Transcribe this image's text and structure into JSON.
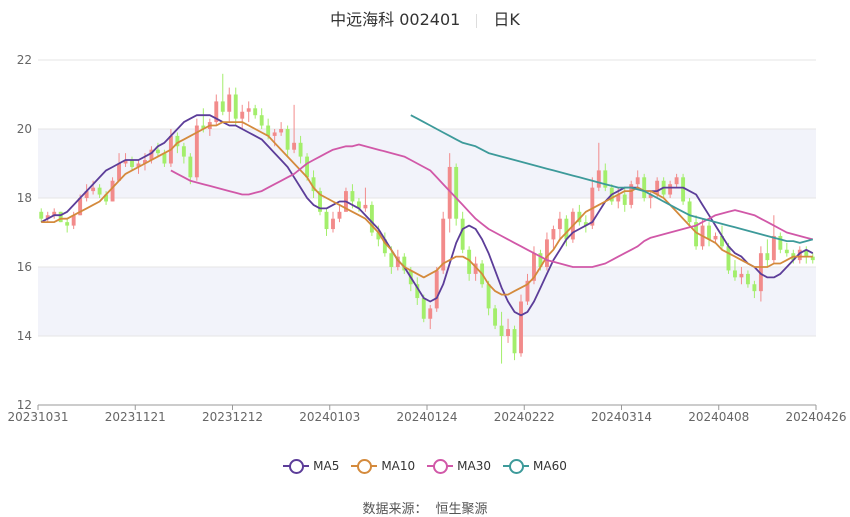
{
  "header": {
    "title": "中远海科 002401",
    "period": "日K"
  },
  "colors": {
    "up": "#f28b8b",
    "down": "#a3ee6b",
    "ma5": "#5c3d99",
    "ma10": "#d48a3c",
    "ma30": "#d158a8",
    "ma60": "#3d9a9a",
    "band": "#f2f3fa",
    "grid": "#e6e6e6"
  },
  "legend": [
    {
      "name": "MA5",
      "color": "#5c3d99"
    },
    {
      "name": "MA10",
      "color": "#d48a3c"
    },
    {
      "name": "MA30",
      "color": "#d158a8"
    },
    {
      "name": "MA60",
      "color": "#3d9a9a"
    }
  ],
  "source": {
    "label": "数据来源：",
    "name": "恒生聚源"
  },
  "chart_data": {
    "type": "candlestick",
    "title": "中远海科 002401 日K",
    "ylim": [
      12,
      22
    ],
    "yticks": [
      12,
      14,
      16,
      18,
      20,
      22
    ],
    "xticks": [
      "20231031",
      "20231121",
      "20231212",
      "20240103",
      "20240124",
      "20240222",
      "20240314",
      "20240408",
      "20240426"
    ],
    "grid": true,
    "legend_position": "bottom",
    "n_days": 120,
    "ohlc": [
      [
        17.6,
        17.7,
        17.3,
        17.4
      ],
      [
        17.4,
        17.6,
        17.3,
        17.5
      ],
      [
        17.5,
        17.7,
        17.4,
        17.6
      ],
      [
        17.6,
        17.6,
        17.3,
        17.3
      ],
      [
        17.3,
        17.4,
        17.0,
        17.2
      ],
      [
        17.2,
        17.6,
        17.1,
        17.5
      ],
      [
        17.5,
        18.1,
        17.5,
        18.0
      ],
      [
        18.0,
        18.4,
        17.9,
        18.2
      ],
      [
        18.2,
        18.5,
        18.1,
        18.3
      ],
      [
        18.3,
        18.4,
        18.0,
        18.1
      ],
      [
        18.1,
        18.2,
        17.8,
        17.9
      ],
      [
        17.9,
        18.6,
        17.9,
        18.5
      ],
      [
        18.5,
        19.3,
        18.5,
        19.0
      ],
      [
        19.0,
        19.3,
        18.9,
        19.1
      ],
      [
        19.1,
        19.2,
        18.8,
        18.9
      ],
      [
        18.9,
        19.1,
        18.7,
        19.0
      ],
      [
        19.0,
        19.3,
        18.8,
        19.1
      ],
      [
        19.1,
        19.5,
        19.0,
        19.4
      ],
      [
        19.4,
        19.6,
        19.2,
        19.3
      ],
      [
        19.3,
        19.4,
        18.9,
        19.0
      ],
      [
        19.0,
        20.0,
        18.9,
        19.8
      ],
      [
        19.8,
        19.9,
        19.3,
        19.5
      ],
      [
        19.5,
        19.6,
        19.0,
        19.2
      ],
      [
        19.2,
        19.3,
        18.4,
        18.6
      ],
      [
        18.6,
        20.3,
        18.5,
        20.1
      ],
      [
        20.1,
        20.6,
        19.9,
        20.0
      ],
      [
        20.0,
        20.3,
        19.8,
        20.2
      ],
      [
        20.2,
        21.0,
        20.1,
        20.8
      ],
      [
        20.8,
        21.6,
        20.4,
        20.5
      ],
      [
        20.5,
        21.2,
        20.2,
        21.0
      ],
      [
        21.0,
        21.2,
        20.1,
        20.3
      ],
      [
        20.3,
        20.7,
        20.0,
        20.5
      ],
      [
        20.5,
        20.8,
        20.2,
        20.6
      ],
      [
        20.6,
        20.7,
        20.3,
        20.4
      ],
      [
        20.4,
        20.6,
        20.0,
        20.1
      ],
      [
        20.1,
        20.3,
        19.7,
        19.8
      ],
      [
        19.8,
        20.0,
        19.5,
        19.9
      ],
      [
        19.9,
        20.2,
        19.8,
        20.0
      ],
      [
        20.0,
        20.1,
        19.2,
        19.4
      ],
      [
        19.4,
        20.7,
        19.3,
        19.6
      ],
      [
        19.6,
        19.8,
        19.0,
        19.2
      ],
      [
        19.2,
        19.3,
        18.5,
        18.6
      ],
      [
        18.6,
        18.8,
        18.0,
        18.2
      ],
      [
        18.2,
        18.3,
        17.5,
        17.6
      ],
      [
        17.6,
        17.7,
        16.9,
        17.1
      ],
      [
        17.1,
        17.6,
        17.0,
        17.4
      ],
      [
        17.4,
        17.8,
        17.3,
        17.6
      ],
      [
        17.6,
        18.3,
        17.6,
        18.2
      ],
      [
        18.2,
        18.4,
        17.7,
        17.9
      ],
      [
        17.9,
        18.0,
        17.6,
        17.7
      ],
      [
        17.7,
        18.3,
        17.6,
        17.8
      ],
      [
        17.8,
        17.9,
        16.9,
        17.0
      ],
      [
        17.0,
        17.2,
        16.6,
        16.8
      ],
      [
        16.8,
        17.0,
        16.3,
        16.4
      ],
      [
        16.4,
        16.6,
        15.8,
        16.0
      ],
      [
        16.0,
        16.5,
        15.9,
        16.3
      ],
      [
        16.3,
        16.4,
        15.8,
        15.9
      ],
      [
        15.9,
        16.0,
        15.3,
        15.5
      ],
      [
        15.5,
        15.7,
        14.9,
        15.1
      ],
      [
        15.1,
        15.2,
        14.4,
        14.5
      ],
      [
        14.5,
        14.9,
        14.2,
        14.8
      ],
      [
        14.8,
        16.0,
        14.7,
        15.9
      ],
      [
        15.9,
        17.6,
        15.8,
        17.4
      ],
      [
        17.4,
        19.3,
        17.0,
        18.9
      ],
      [
        18.9,
        19.0,
        17.2,
        17.4
      ],
      [
        17.4,
        17.6,
        16.4,
        16.5
      ],
      [
        16.5,
        16.6,
        15.6,
        15.8
      ],
      [
        15.8,
        16.3,
        15.6,
        16.1
      ],
      [
        16.1,
        16.2,
        15.4,
        15.5
      ],
      [
        15.5,
        15.6,
        14.6,
        14.8
      ],
      [
        14.8,
        14.9,
        14.2,
        14.3
      ],
      [
        14.3,
        14.7,
        13.2,
        14.0
      ],
      [
        14.0,
        14.5,
        13.8,
        14.2
      ],
      [
        14.2,
        14.3,
        13.3,
        13.5
      ],
      [
        13.5,
        15.2,
        13.4,
        15.0
      ],
      [
        15.0,
        15.8,
        14.9,
        15.6
      ],
      [
        15.6,
        16.6,
        15.5,
        16.4
      ],
      [
        16.4,
        16.5,
        15.9,
        16.0
      ],
      [
        16.0,
        17.0,
        15.9,
        16.8
      ],
      [
        16.8,
        17.2,
        16.5,
        17.1
      ],
      [
        17.1,
        17.6,
        16.8,
        17.4
      ],
      [
        17.4,
        17.5,
        16.6,
        16.8
      ],
      [
        16.8,
        17.7,
        16.7,
        17.6
      ],
      [
        17.6,
        17.8,
        17.2,
        17.3
      ],
      [
        17.3,
        17.5,
        17.0,
        17.2
      ],
      [
        17.2,
        18.6,
        17.1,
        18.3
      ],
      [
        18.3,
        19.6,
        18.2,
        18.8
      ],
      [
        18.8,
        19.0,
        18.2,
        18.3
      ],
      [
        18.3,
        18.4,
        17.8,
        17.9
      ],
      [
        17.9,
        18.3,
        17.7,
        18.1
      ],
      [
        18.1,
        18.3,
        17.6,
        17.8
      ],
      [
        17.8,
        18.5,
        17.7,
        18.4
      ],
      [
        18.4,
        18.8,
        18.3,
        18.6
      ],
      [
        18.6,
        18.7,
        17.9,
        18.0
      ],
      [
        18.0,
        18.2,
        17.7,
        18.1
      ],
      [
        18.1,
        18.6,
        18.0,
        18.5
      ],
      [
        18.5,
        18.6,
        18.0,
        18.1
      ],
      [
        18.1,
        18.5,
        18.0,
        18.4
      ],
      [
        18.4,
        18.7,
        18.3,
        18.6
      ],
      [
        18.6,
        18.7,
        17.8,
        17.9
      ],
      [
        17.9,
        18.0,
        17.2,
        17.3
      ],
      [
        17.3,
        17.5,
        16.5,
        16.6
      ],
      [
        16.6,
        17.4,
        16.5,
        17.2
      ],
      [
        17.2,
        17.3,
        16.6,
        16.8
      ],
      [
        16.8,
        17.0,
        16.7,
        16.9
      ],
      [
        16.9,
        17.2,
        16.5,
        16.6
      ],
      [
        16.6,
        16.7,
        15.8,
        15.9
      ],
      [
        15.9,
        16.2,
        15.6,
        15.7
      ],
      [
        15.7,
        16.0,
        15.5,
        15.8
      ],
      [
        15.8,
        15.9,
        15.4,
        15.5
      ],
      [
        15.5,
        15.6,
        15.1,
        15.3
      ],
      [
        15.3,
        16.6,
        15.0,
        16.4
      ],
      [
        16.4,
        16.8,
        16.0,
        16.2
      ],
      [
        16.2,
        17.5,
        16.1,
        16.9
      ],
      [
        16.9,
        17.0,
        16.4,
        16.5
      ],
      [
        16.5,
        16.7,
        16.3,
        16.4
      ],
      [
        16.4,
        16.5,
        16.1,
        16.2
      ],
      [
        16.2,
        16.6,
        16.1,
        16.5
      ],
      [
        16.5,
        16.6,
        16.1,
        16.3
      ],
      [
        16.3,
        16.4,
        16.1,
        16.2
      ]
    ],
    "series": [
      {
        "name": "MA5",
        "values": [
          17.3,
          17.4,
          17.5,
          17.5,
          17.6,
          17.8,
          18.0,
          18.2,
          18.4,
          18.6,
          18.8,
          18.9,
          19.0,
          19.1,
          19.1,
          19.1,
          19.2,
          19.3,
          19.5,
          19.6,
          19.8,
          20.0,
          20.2,
          20.3,
          20.4,
          20.4,
          20.4,
          20.3,
          20.2,
          20.1,
          20.1,
          20.0,
          19.9,
          19.8,
          19.7,
          19.5,
          19.3,
          19.1,
          18.9,
          18.6,
          18.3,
          18.0,
          17.8,
          17.7,
          17.7,
          17.8,
          17.9,
          17.9,
          17.8,
          17.7,
          17.5,
          17.3,
          17.1,
          16.8,
          16.5,
          16.2,
          16.0,
          15.7,
          15.4,
          15.1,
          15.0,
          15.1,
          15.5,
          16.1,
          16.7,
          17.1,
          17.2,
          17.1,
          16.8,
          16.4,
          15.9,
          15.4,
          15.0,
          14.7,
          14.6,
          14.7,
          15.0,
          15.4,
          15.8,
          16.2,
          16.5,
          16.8,
          17.0,
          17.1,
          17.2,
          17.3,
          17.6,
          17.9,
          18.1,
          18.2,
          18.3,
          18.3,
          18.3,
          18.2,
          18.2,
          18.2,
          18.3,
          18.3,
          18.3,
          18.3,
          18.2,
          18.1,
          17.8,
          17.5,
          17.2,
          16.9,
          16.6,
          16.4,
          16.3,
          16.1,
          16.0,
          15.8,
          15.7,
          15.7,
          15.8,
          16.0,
          16.2,
          16.4,
          16.5,
          16.4
        ]
      },
      {
        "name": "MA10",
        "values": [
          17.3,
          17.3,
          17.3,
          17.4,
          17.4,
          17.5,
          17.6,
          17.7,
          17.8,
          17.9,
          18.1,
          18.3,
          18.5,
          18.7,
          18.8,
          18.9,
          19.0,
          19.1,
          19.2,
          19.3,
          19.4,
          19.6,
          19.7,
          19.8,
          19.9,
          20.0,
          20.1,
          20.1,
          20.2,
          20.2,
          20.2,
          20.2,
          20.1,
          20.0,
          19.9,
          19.8,
          19.6,
          19.4,
          19.2,
          19.0,
          18.8,
          18.6,
          18.3,
          18.1,
          18.0,
          17.9,
          17.8,
          17.7,
          17.6,
          17.5,
          17.4,
          17.2,
          17.0,
          16.7,
          16.5,
          16.2,
          16.0,
          15.9,
          15.8,
          15.7,
          15.8,
          15.9,
          16.1,
          16.2,
          16.3,
          16.3,
          16.2,
          16.0,
          15.8,
          15.5,
          15.3,
          15.2,
          15.2,
          15.3,
          15.4,
          15.5,
          15.7,
          16.0,
          16.3,
          16.5,
          16.8,
          17.0,
          17.2,
          17.4,
          17.6,
          17.7,
          17.8,
          17.9,
          18.0,
          18.1,
          18.2,
          18.2,
          18.3,
          18.2,
          18.2,
          18.1,
          18.0,
          17.8,
          17.6,
          17.4,
          17.2,
          17.0,
          16.9,
          16.8,
          16.7,
          16.5,
          16.4,
          16.3,
          16.2,
          16.1,
          16.0,
          16.0,
          16.0,
          16.1,
          16.1,
          16.2,
          16.3,
          16.3,
          16.3,
          16.3
        ]
      },
      {
        "name": "MA30",
        "values": [
          18.8,
          18.7,
          18.6,
          18.5,
          18.45,
          18.4,
          18.35,
          18.3,
          18.25,
          18.2,
          18.15,
          18.1,
          18.1,
          18.15,
          18.2,
          18.3,
          18.4,
          18.5,
          18.6,
          18.7,
          18.85,
          19.0,
          19.1,
          19.2,
          19.3,
          19.4,
          19.45,
          19.5,
          19.5,
          19.55,
          19.5,
          19.45,
          19.4,
          19.35,
          19.3,
          19.25,
          19.2,
          19.1,
          19.0,
          18.9,
          18.8,
          18.6,
          18.4,
          18.2,
          18.0,
          17.8,
          17.6,
          17.4,
          17.25,
          17.1,
          17.0,
          16.9,
          16.8,
          16.7,
          16.6,
          16.5,
          16.4,
          16.3,
          16.2,
          16.15,
          16.1,
          16.05,
          16.0,
          16.0,
          16.0,
          16.0,
          16.05,
          16.1,
          16.2,
          16.3,
          16.4,
          16.5,
          16.6,
          16.75,
          16.85,
          16.9,
          16.95,
          17.0,
          17.05,
          17.1,
          17.15,
          17.2,
          17.3,
          17.4,
          17.5,
          17.55,
          17.6,
          17.65,
          17.6,
          17.55,
          17.5,
          17.4,
          17.3,
          17.2,
          17.1,
          17.0,
          16.95,
          16.9,
          16.85,
          16.8
        ]
      },
      {
        "name": "MA60",
        "values": [
          20.4,
          20.3,
          20.2,
          20.1,
          20.0,
          19.9,
          19.8,
          19.7,
          19.6,
          19.55,
          19.5,
          19.4,
          19.3,
          19.25,
          19.2,
          19.15,
          19.1,
          19.05,
          19.0,
          18.95,
          18.9,
          18.85,
          18.8,
          18.75,
          18.7,
          18.65,
          18.6,
          18.55,
          18.5,
          18.45,
          18.4,
          18.35,
          18.3,
          18.3,
          18.3,
          18.25,
          18.2,
          18.1,
          18.0,
          17.9,
          17.8,
          17.7,
          17.6,
          17.5,
          17.45,
          17.4,
          17.35,
          17.3,
          17.25,
          17.2,
          17.15,
          17.1,
          17.05,
          17.0,
          16.95,
          16.9,
          16.85,
          16.8,
          16.75,
          16.75,
          16.7,
          16.75,
          16.8
        ]
      }
    ]
  }
}
